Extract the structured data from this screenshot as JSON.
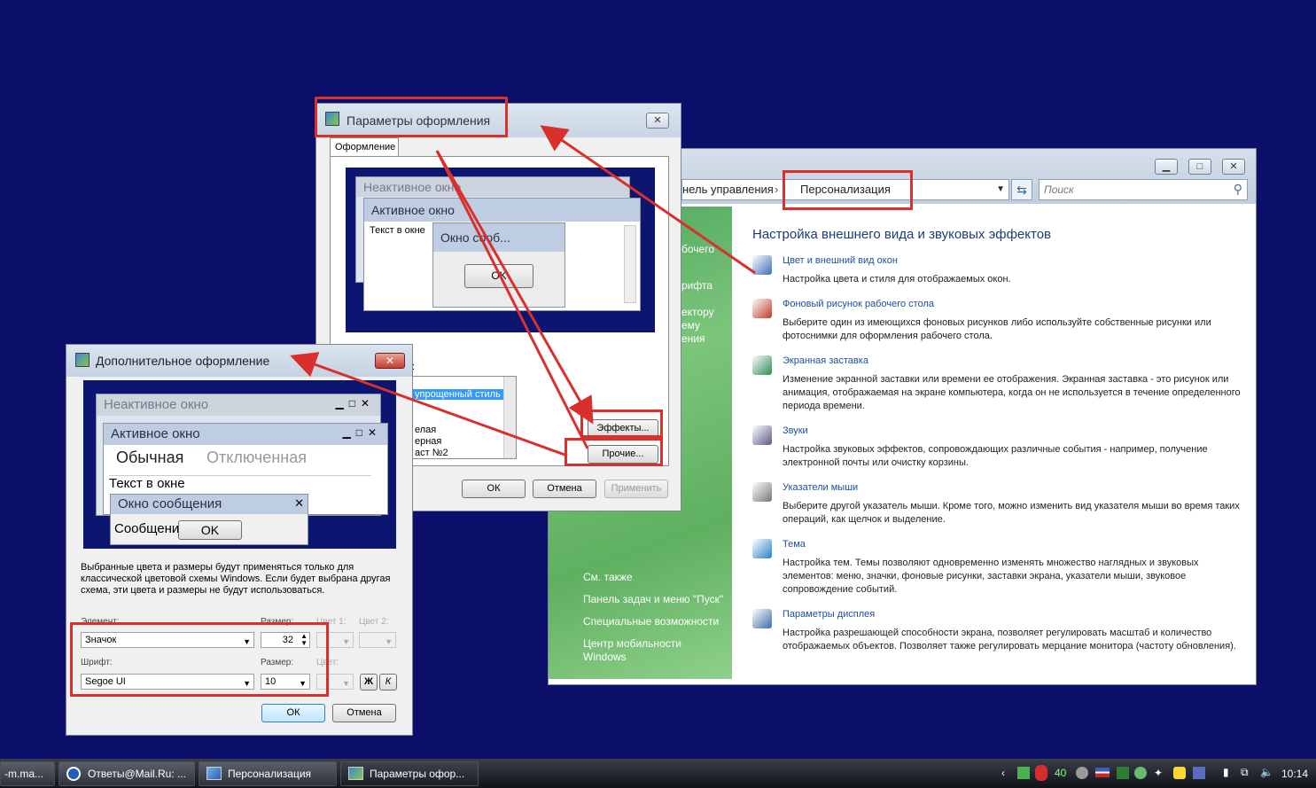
{
  "personalization": {
    "breadcrumb_prev": "нель управления",
    "breadcrumb_current": "Персонализация",
    "search_placeholder": "Поиск",
    "heading": "Настройка внешнего вида и звуковых эффектов",
    "sidebar_fragments": [
      "бочего",
      "рифта",
      "ектору",
      "ему",
      "ения"
    ],
    "see_also": "См. также",
    "see_also_links": [
      "Панель задач и меню \"Пуск\"",
      "Специальные возможности",
      "Центр мобильности",
      "Windows"
    ],
    "items": [
      {
        "title": "Цвет и внешний вид окон",
        "desc": "Настройка цвета и стиля для отображаемых окон.",
        "icon": "window-color-icon"
      },
      {
        "title": "Фоновый рисунок рабочего стола",
        "desc": "Выберите один из имеющихся фоновых рисунков либо используйте собственные рисунки или фотоснимки для оформления рабочего стола.",
        "icon": "desktop-background-icon"
      },
      {
        "title": "Экранная заставка",
        "desc": "Изменение экранной заставки или времени ее отображения. Экранная заставка - это рисунок или анимация, отображаемая на экране компьютера, когда он не используется в течение определенного периода времени.",
        "icon": "screensaver-icon"
      },
      {
        "title": "Звуки",
        "desc": "Настройка звуковых эффектов, сопровождающих различные события - например, получение электронной почты или очистку корзины.",
        "icon": "sounds-icon"
      },
      {
        "title": "Указатели мыши",
        "desc": "Выберите другой указатель мыши. Кроме того, можно изменить вид указателя мыши во время таких операций, как щелчок и выделение.",
        "icon": "mouse-pointer-icon"
      },
      {
        "title": "Тема",
        "desc": "Настройка тем. Темы позволяют одновременно изменять множество наглядных и звуковых элементов: меню, значки, фоновые рисунки, заставки экрана, указатели мыши, звуковое сопровождение событий.",
        "icon": "theme-icon"
      },
      {
        "title": "Параметры дисплея",
        "desc": "Настройка разрешающей способности экрана, позволяет регулировать масштаб и количество отображаемых объектов. Позволяет также регулировать мерцание монитора (частоту обновления).",
        "icon": "display-settings-icon"
      }
    ]
  },
  "appearance": {
    "title": "Параметры оформления",
    "tab": "Оформление",
    "preview": {
      "inactive": "Неактивное окно",
      "active": "Активное окно",
      "window_text": "Текст в окне",
      "message": "Окно сооб...",
      "ok": "OK"
    },
    "label_fragment": ":",
    "list_items": [
      "упрощенный стиль",
      "елая",
      "ерная",
      "аст №2"
    ],
    "effects_button": "Эффекты...",
    "advanced_button": "Прочие...",
    "ok": "ОК",
    "cancel": "Отмена",
    "apply": "Применить"
  },
  "advanced": {
    "title": "Дополнительное оформление",
    "preview": {
      "inactive": "Неактивное окно",
      "active": "Активное окно",
      "normal": "Обычная",
      "disabled": "Отключенная",
      "window_text": "Текст в окне",
      "message_title": "Окно сообщения",
      "message_text": "Сообщени",
      "ok": "OK"
    },
    "info": "Выбранные цвета и размеры будут применяться только для классической цветовой схемы Windows. Если будет выбрана другая схема, эти цвета и размеры не будут использоваться.",
    "element_label": "Элемент:",
    "element_value": "Значок",
    "size_label": "Размер:",
    "size_value": "32",
    "color1_label": "Цвет 1:",
    "color2_label": "Цвет 2:",
    "font_label": "Шрифт:",
    "font_value": "Segoe UI",
    "font_size_label": "Размер:",
    "font_size_value": "10",
    "font_color_label": "Цвет:",
    "bold": "Ж",
    "italic": "К",
    "ok": "ОК",
    "cancel": "Отмена"
  },
  "taskbar": {
    "items": [
      "-m.ma...",
      "Ответы@Mail.Ru: ...",
      "Персонализация",
      "Параметры офор..."
    ],
    "tray_number": "40",
    "clock": "10:14"
  }
}
